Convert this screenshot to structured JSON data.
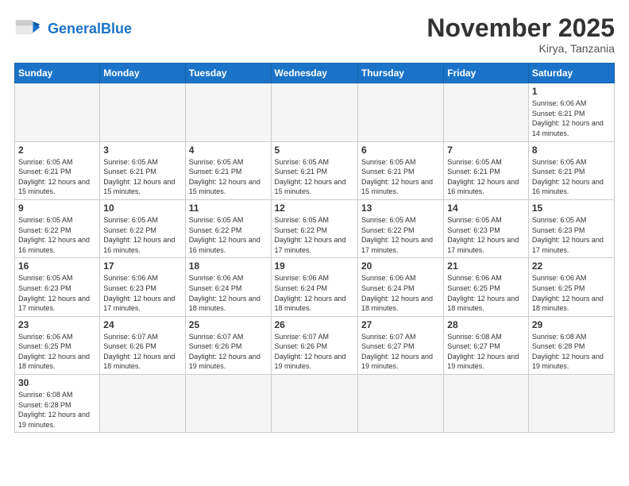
{
  "header": {
    "logo_general": "General",
    "logo_blue": "Blue",
    "month_title": "November 2025",
    "location": "Kirya, Tanzania"
  },
  "days_of_week": [
    "Sunday",
    "Monday",
    "Tuesday",
    "Wednesday",
    "Thursday",
    "Friday",
    "Saturday"
  ],
  "weeks": [
    [
      {
        "day": "",
        "info": ""
      },
      {
        "day": "",
        "info": ""
      },
      {
        "day": "",
        "info": ""
      },
      {
        "day": "",
        "info": ""
      },
      {
        "day": "",
        "info": ""
      },
      {
        "day": "",
        "info": ""
      },
      {
        "day": "1",
        "info": "Sunrise: 6:06 AM\nSunset: 6:21 PM\nDaylight: 12 hours and 14 minutes."
      }
    ],
    [
      {
        "day": "2",
        "info": "Sunrise: 6:05 AM\nSunset: 6:21 PM\nDaylight: 12 hours and 15 minutes."
      },
      {
        "day": "3",
        "info": "Sunrise: 6:05 AM\nSunset: 6:21 PM\nDaylight: 12 hours and 15 minutes."
      },
      {
        "day": "4",
        "info": "Sunrise: 6:05 AM\nSunset: 6:21 PM\nDaylight: 12 hours and 15 minutes."
      },
      {
        "day": "5",
        "info": "Sunrise: 6:05 AM\nSunset: 6:21 PM\nDaylight: 12 hours and 15 minutes."
      },
      {
        "day": "6",
        "info": "Sunrise: 6:05 AM\nSunset: 6:21 PM\nDaylight: 12 hours and 15 minutes."
      },
      {
        "day": "7",
        "info": "Sunrise: 6:05 AM\nSunset: 6:21 PM\nDaylight: 12 hours and 16 minutes."
      },
      {
        "day": "8",
        "info": "Sunrise: 6:05 AM\nSunset: 6:21 PM\nDaylight: 12 hours and 16 minutes."
      }
    ],
    [
      {
        "day": "9",
        "info": "Sunrise: 6:05 AM\nSunset: 6:22 PM\nDaylight: 12 hours and 16 minutes."
      },
      {
        "day": "10",
        "info": "Sunrise: 6:05 AM\nSunset: 6:22 PM\nDaylight: 12 hours and 16 minutes."
      },
      {
        "day": "11",
        "info": "Sunrise: 6:05 AM\nSunset: 6:22 PM\nDaylight: 12 hours and 16 minutes."
      },
      {
        "day": "12",
        "info": "Sunrise: 6:05 AM\nSunset: 6:22 PM\nDaylight: 12 hours and 17 minutes."
      },
      {
        "day": "13",
        "info": "Sunrise: 6:05 AM\nSunset: 6:22 PM\nDaylight: 12 hours and 17 minutes."
      },
      {
        "day": "14",
        "info": "Sunrise: 6:05 AM\nSunset: 6:23 PM\nDaylight: 12 hours and 17 minutes."
      },
      {
        "day": "15",
        "info": "Sunrise: 6:05 AM\nSunset: 6:23 PM\nDaylight: 12 hours and 17 minutes."
      }
    ],
    [
      {
        "day": "16",
        "info": "Sunrise: 6:05 AM\nSunset: 6:23 PM\nDaylight: 12 hours and 17 minutes."
      },
      {
        "day": "17",
        "info": "Sunrise: 6:06 AM\nSunset: 6:23 PM\nDaylight: 12 hours and 17 minutes."
      },
      {
        "day": "18",
        "info": "Sunrise: 6:06 AM\nSunset: 6:24 PM\nDaylight: 12 hours and 18 minutes."
      },
      {
        "day": "19",
        "info": "Sunrise: 6:06 AM\nSunset: 6:24 PM\nDaylight: 12 hours and 18 minutes."
      },
      {
        "day": "20",
        "info": "Sunrise: 6:06 AM\nSunset: 6:24 PM\nDaylight: 12 hours and 18 minutes."
      },
      {
        "day": "21",
        "info": "Sunrise: 6:06 AM\nSunset: 6:25 PM\nDaylight: 12 hours and 18 minutes."
      },
      {
        "day": "22",
        "info": "Sunrise: 6:06 AM\nSunset: 6:25 PM\nDaylight: 12 hours and 18 minutes."
      }
    ],
    [
      {
        "day": "23",
        "info": "Sunrise: 6:06 AM\nSunset: 6:25 PM\nDaylight: 12 hours and 18 minutes."
      },
      {
        "day": "24",
        "info": "Sunrise: 6:07 AM\nSunset: 6:26 PM\nDaylight: 12 hours and 18 minutes."
      },
      {
        "day": "25",
        "info": "Sunrise: 6:07 AM\nSunset: 6:26 PM\nDaylight: 12 hours and 19 minutes."
      },
      {
        "day": "26",
        "info": "Sunrise: 6:07 AM\nSunset: 6:26 PM\nDaylight: 12 hours and 19 minutes."
      },
      {
        "day": "27",
        "info": "Sunrise: 6:07 AM\nSunset: 6:27 PM\nDaylight: 12 hours and 19 minutes."
      },
      {
        "day": "28",
        "info": "Sunrise: 6:08 AM\nSunset: 6:27 PM\nDaylight: 12 hours and 19 minutes."
      },
      {
        "day": "29",
        "info": "Sunrise: 6:08 AM\nSunset: 6:28 PM\nDaylight: 12 hours and 19 minutes."
      }
    ],
    [
      {
        "day": "30",
        "info": "Sunrise: 6:08 AM\nSunset: 6:28 PM\nDaylight: 12 hours and 19 minutes."
      },
      {
        "day": "",
        "info": ""
      },
      {
        "day": "",
        "info": ""
      },
      {
        "day": "",
        "info": ""
      },
      {
        "day": "",
        "info": ""
      },
      {
        "day": "",
        "info": ""
      },
      {
        "day": "",
        "info": ""
      }
    ]
  ]
}
